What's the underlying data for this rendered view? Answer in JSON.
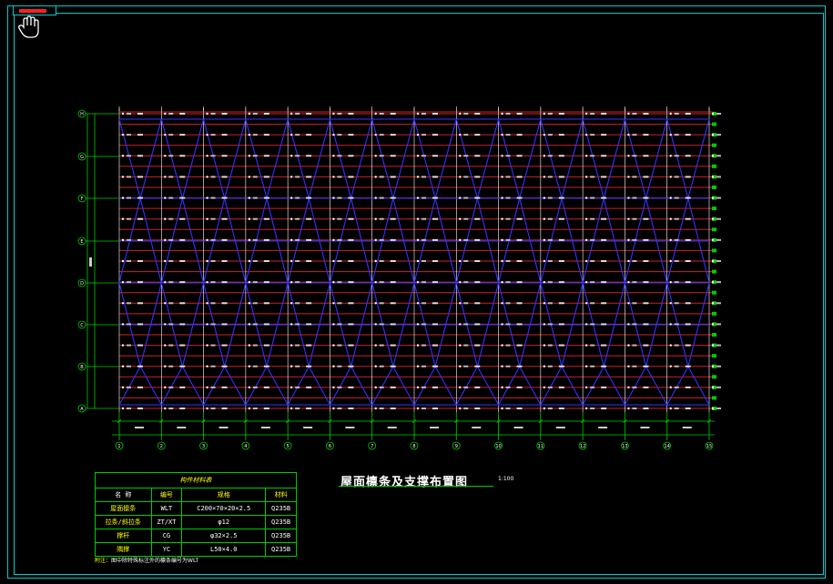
{
  "drawing": {
    "title": "屋面檩条及支撑布置图",
    "scale": "1:100"
  },
  "legend": {
    "title": "构件材料表",
    "headers": [
      "名 称",
      "编号",
      "规格",
      "材料"
    ],
    "rows": [
      [
        "屋面檩条",
        "WLT",
        "C200×70×20×2.5",
        "Q235B"
      ],
      [
        "拉条/斜拉条",
        "ZT/XT",
        "φ12",
        "Q235B"
      ],
      [
        "撑杆",
        "CG",
        "φ32×2.5",
        "Q235B"
      ],
      [
        "隅撑",
        "YC",
        "L50×4.0",
        "Q235B"
      ]
    ]
  },
  "note": {
    "prefix": "附注：",
    "text": "图中除特殊标注外的檩条编号为WLT"
  },
  "axes": {
    "columns": [
      "1",
      "2",
      "3",
      "4",
      "5",
      "6",
      "7",
      "8",
      "9",
      "10",
      "11",
      "12",
      "13",
      "14",
      "15"
    ],
    "rows": [
      "A",
      "B",
      "C",
      "D",
      "E",
      "F",
      "G",
      "H"
    ]
  },
  "colors": {
    "background": "#000000",
    "purlin": "#cc2222",
    "brace": "#3333ff",
    "grid": "#00cc00",
    "frame": "#00cccc",
    "text": "#ffffff",
    "table_text": "#ffff00"
  },
  "icons": {
    "cursor": "pan-hand-icon",
    "tab_marker": "layout-tab-icon"
  }
}
